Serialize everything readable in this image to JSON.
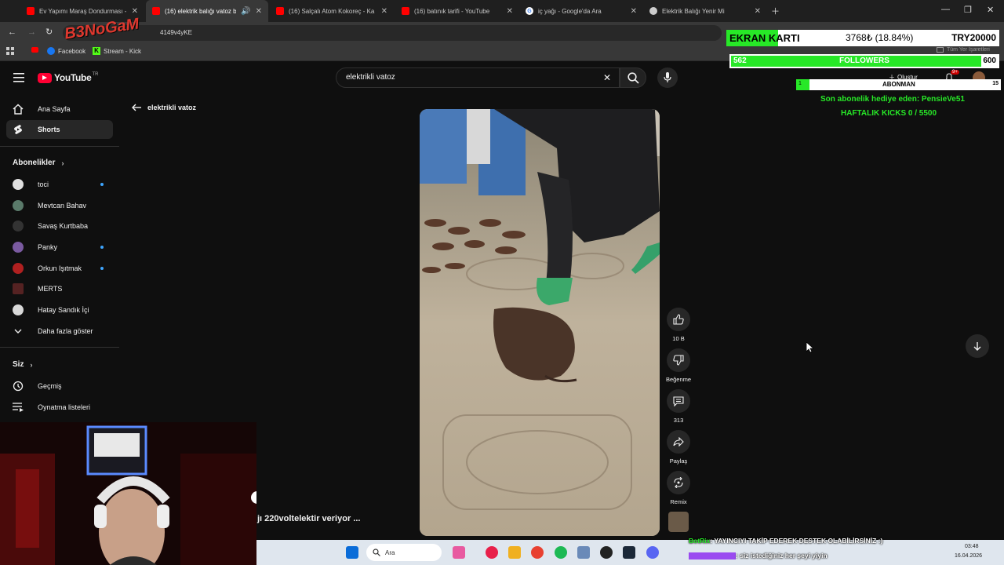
{
  "browser": {
    "tabs": [
      {
        "title": "Ev Yapımı Maraş Dondurması -",
        "icon": "youtube-icon",
        "active": false
      },
      {
        "title": "(16) elektrik balığı vatoz ba",
        "icon": "youtube-icon",
        "active": true
      },
      {
        "title": "(16) Salçalı Atom Kokoreç - Ka",
        "icon": "youtube-icon",
        "active": false
      },
      {
        "title": "(16) batınık tarifi - YouTube",
        "icon": "youtube-icon",
        "active": false
      },
      {
        "title": "iç yağı - Google'da Ara",
        "icon": "google-icon",
        "active": false
      },
      {
        "title": "Elektrik Balığı Yenir Mi",
        "icon": "globe-icon",
        "active": false
      }
    ],
    "url_fragment": "4149v4yKE",
    "bookmarks": [
      {
        "label": "Facebook",
        "icon": "facebook-icon"
      },
      {
        "label": "Stream - Kick",
        "icon": "kick-icon"
      }
    ],
    "bookmarks_right": "Tüm Yer İşaretleri"
  },
  "youtube": {
    "logo_text": "YouTube",
    "logo_region": "TR",
    "search_value": "elektrikli vatoz",
    "create_label": "Oluştur",
    "notif_badge": "9+",
    "sidebar": {
      "main": [
        {
          "label": "Ana Sayfa",
          "icon": "home-icon",
          "active": false
        },
        {
          "label": "Shorts",
          "icon": "shorts-icon",
          "active": true
        }
      ],
      "subs_header": "Abonelikler",
      "subscriptions": [
        {
          "label": "toci",
          "dot": true
        },
        {
          "label": "Mevtcan Bahav",
          "dot": false
        },
        {
          "label": "Savaş Kurtbaba",
          "dot": false
        },
        {
          "label": "Panky",
          "dot": true
        },
        {
          "label": "Orkun Işıtmak",
          "dot": true
        },
        {
          "label": "MERTS",
          "dot": false
        },
        {
          "label": "Hatay Sandık İçi",
          "dot": false
        },
        {
          "label": "Daha fazla göster",
          "dot": false
        }
      ],
      "you_header": "Siz",
      "you_items": [
        {
          "label": "Geçmiş",
          "icon": "history-icon"
        },
        {
          "label": "Oynatma listeleri",
          "icon": "playlist-icon"
        }
      ]
    },
    "back_label": "elektrikli vatoz",
    "actions": {
      "like_count": "10 B",
      "dislike_label": "Beğenme",
      "comment_count": "313",
      "share_label": "Paylaş",
      "remix_label": "Remix"
    },
    "channel_caption": "jı 220voltelektir veriyor ..."
  },
  "overlay": {
    "ekran_label": "EKRAN KARTI",
    "ekran_amount": "3768₺ (18.84%)",
    "ekran_goal": "TRY20000",
    "ekran_progress": 0.1884,
    "followers_current": "562",
    "followers_label": "FOLLOWERS",
    "followers_goal": "600",
    "followers_progress": 0.937,
    "abonman_label": "ABONMAN",
    "abonman_count": "1",
    "abonman_goal": "15",
    "abonman_progress": 0.067,
    "sub_gift": "Son abonelik hediye eden: PensieVe51",
    "weekly_kicks": "HAFTALIK KICKS 0 / 5500",
    "watermark": "B3NoGaM",
    "chat1_user": "BotRix",
    "chat1_msg": ": YAYINCIYI TAKİP EDEREK DESTEK OLABİLİRSİNİZ :)",
    "chat2_msg": ": siz istediğiniz her şeyi yiyin"
  },
  "taskbar": {
    "search_placeholder": "Ara",
    "time": "03:48",
    "date": "16.04.2026"
  },
  "colors": {
    "accent_green": "#27e827",
    "yt_red": "#ff0033",
    "link_blue": "#3ea6ff"
  }
}
